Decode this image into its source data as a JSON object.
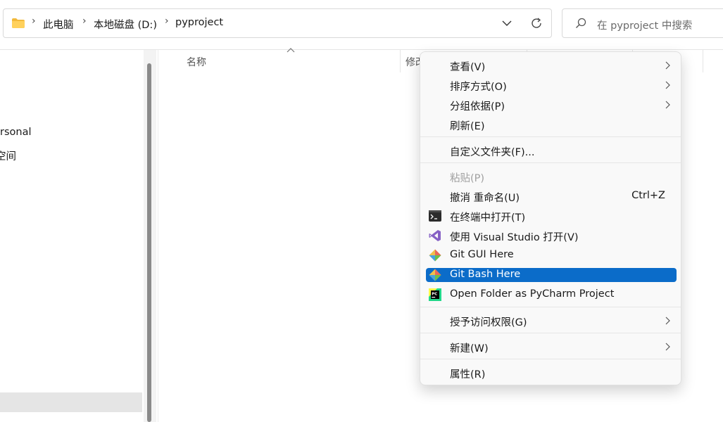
{
  "address_bar": {
    "crumbs": [
      "此电脑",
      "本地磁盘 (D:)",
      "pyproject"
    ]
  },
  "search": {
    "placeholder": "在 pyproject 中搜索"
  },
  "nav": {
    "items": [
      "rsonal",
      "空间"
    ]
  },
  "columns": {
    "name": "名称",
    "modified": "修改"
  },
  "context_menu": {
    "view": "查看(V)",
    "sort": "排序方式(O)",
    "group": "分组依据(P)",
    "refresh": "刷新(E)",
    "customize": "自定义文件夹(F)...",
    "paste": "粘贴(P)",
    "undo": "撤消 重命名(U)",
    "undo_shortcut": "Ctrl+Z",
    "terminal": "在终端中打开(T)",
    "visual_studio": "使用 Visual Studio 打开(V)",
    "git_gui": "Git GUI Here",
    "git_bash": "Git Bash Here",
    "pycharm": "Open Folder as PyCharm Project",
    "access": "授予访问权限(G)",
    "new": "新建(W)",
    "properties": "属性(R)"
  },
  "colors": {
    "accent": "#0b6cc9",
    "folder": "#f2b93b"
  },
  "icons": [
    "folder-icon",
    "chevron-right-icon",
    "chevron-down-icon",
    "refresh-icon",
    "search-icon",
    "terminal-icon",
    "visual-studio-icon",
    "git-icon",
    "pycharm-icon"
  ]
}
